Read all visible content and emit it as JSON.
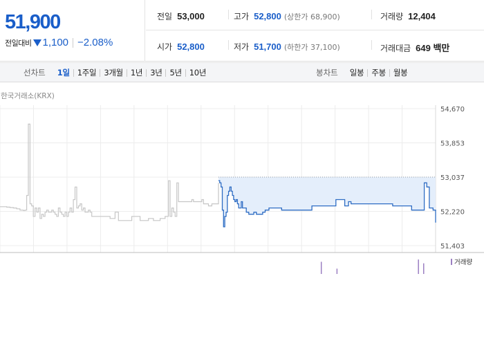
{
  "summary": {
    "price": "51,900",
    "diff_label": "전일대비",
    "diff_value": "1,100",
    "diff_rate": "−2.08%",
    "stats_row1": [
      {
        "key": "전일",
        "value": "53,000",
        "sub": ""
      },
      {
        "key": "고가",
        "value": "52,800",
        "sub": "(상한가 68,900)"
      },
      {
        "key": "거래량",
        "value": "12,404",
        "sub": ""
      }
    ],
    "stats_row2": [
      {
        "key": "시가",
        "value": "52,800",
        "sub": ""
      },
      {
        "key": "저가",
        "value": "51,700",
        "sub": "(하한가 37,100)"
      },
      {
        "key": "거래대금",
        "value": "649 백만",
        "sub": ""
      }
    ]
  },
  "tabs": {
    "line_title": "선차트",
    "line_periods": [
      "1일",
      "1주일",
      "3개월",
      "1년",
      "3년",
      "5년",
      "10년"
    ],
    "candle_title": "봉차트",
    "candle_periods": [
      "일봉",
      "주봉",
      "월봉"
    ]
  },
  "chart": {
    "exchange": "한국거래소(KRX)",
    "volume_legend": "거래량",
    "colors": {
      "today_line": "#2d6cc4",
      "today_fill": "#e4eefb",
      "prev_line": "#c6c6c6",
      "grid": "#ececec",
      "volume": "#9b7fc2"
    }
  },
  "chart_data": {
    "type": "line",
    "y_ticks": [
      "54,670",
      "53,853",
      "53,037",
      "52,220",
      "51,403"
    ],
    "ylim": [
      51403,
      54670
    ],
    "previous_close": 53037,
    "series": [
      {
        "values": [
          52330,
          52330,
          52330,
          52330,
          52320,
          52320,
          52310,
          52310,
          52300,
          52300,
          52280,
          52280,
          52250,
          52250,
          52240,
          52250,
          52600,
          54300,
          52400,
          52350,
          52100,
          52300,
          52200,
          52300,
          52050,
          52150,
          52100,
          52200,
          52250,
          52200,
          52200,
          52250,
          52200,
          52150,
          52100,
          52300,
          52200,
          52150,
          52100,
          52200,
          52100,
          52200,
          52300,
          52200,
          52500,
          52800,
          52300,
          52350,
          52400,
          52250,
          52300,
          52200,
          52200,
          52250,
          52200,
          52100,
          52100,
          52100,
          52100,
          52100,
          52100,
          52100,
          52100,
          52100,
          52100,
          52100,
          52050,
          52050,
          52050,
          52200,
          52200,
          52000,
          52000,
          52000,
          52000,
          52000,
          52000,
          52000,
          52000,
          52100,
          52100,
          52100,
          52100,
          52100,
          52000,
          52000,
          52000,
          52000,
          52000,
          52050,
          52050,
          52050,
          52000,
          52000,
          52000,
          52000,
          52050,
          52050,
          52050,
          52100,
          52100,
          52950,
          52100,
          52300,
          52200,
          52100,
          52900,
          52450,
          52450,
          52450,
          52450,
          52450,
          52450,
          52450,
          52450,
          52500,
          52450,
          52450,
          52450,
          52450,
          52450,
          52500,
          52400,
          52400,
          52400,
          52350,
          52350,
          52400,
          52400,
          52400,
          52400,
          52900
        ]
      },
      {
        "values": [
          52950,
          52900,
          52800,
          52250,
          51850,
          52100,
          52200,
          52600,
          52700,
          52800,
          52700,
          52600,
          52500,
          52450,
          52500,
          52400,
          52300,
          52300,
          52450,
          52300,
          52300,
          52300,
          52200,
          52200,
          52150,
          52150,
          52150,
          52150,
          52200,
          52200,
          52150,
          52150,
          52150,
          52150,
          52150,
          52200,
          52200,
          52250,
          52250,
          52250,
          52300,
          52300,
          52300,
          52300,
          52300,
          52300,
          52300,
          52300,
          52300,
          52300,
          52250,
          52250,
          52250,
          52250,
          52250,
          52250,
          52250,
          52250,
          52250,
          52250,
          52250,
          52250,
          52250,
          52250,
          52250,
          52250,
          52250,
          52250,
          52250,
          52250,
          52250,
          52250,
          52250,
          52250,
          52350,
          52350,
          52350,
          52350,
          52350,
          52350,
          52350,
          52350,
          52350,
          52350,
          52350,
          52350,
          52350,
          52350,
          52350,
          52350,
          52350,
          52350,
          52350,
          52500,
          52500,
          52500,
          52500,
          52500,
          52500,
          52500,
          52350,
          52350,
          52350,
          52450,
          52450,
          52400,
          52400,
          52400,
          52400,
          52400,
          52400,
          52400,
          52400,
          52400,
          52400,
          52400,
          52400,
          52400,
          52400,
          52400,
          52400,
          52400,
          52400,
          52400,
          52400,
          52400,
          52400,
          52400,
          52400,
          52400,
          52400,
          52400,
          52400,
          52400,
          52400,
          52400,
          52400,
          52400,
          52350,
          52350,
          52350,
          52350,
          52350,
          52350,
          52350,
          52350,
          52350,
          52350,
          52350,
          52350,
          52350,
          52350,
          52350,
          52250,
          52250,
          52250,
          52250,
          52250,
          52250,
          52250,
          52250,
          52250,
          52250,
          52900,
          52900,
          52800,
          52800,
          52300,
          52300,
          52300,
          52250,
          52250,
          51950
        ]
      }
    ],
    "volume": [
      {
        "position": 0.765,
        "level": 0.8
      },
      {
        "position": 0.801,
        "level": 0.35
      },
      {
        "position": 0.988,
        "level": 0.95
      },
      {
        "position": 1.0,
        "level": 0.7
      }
    ]
  }
}
